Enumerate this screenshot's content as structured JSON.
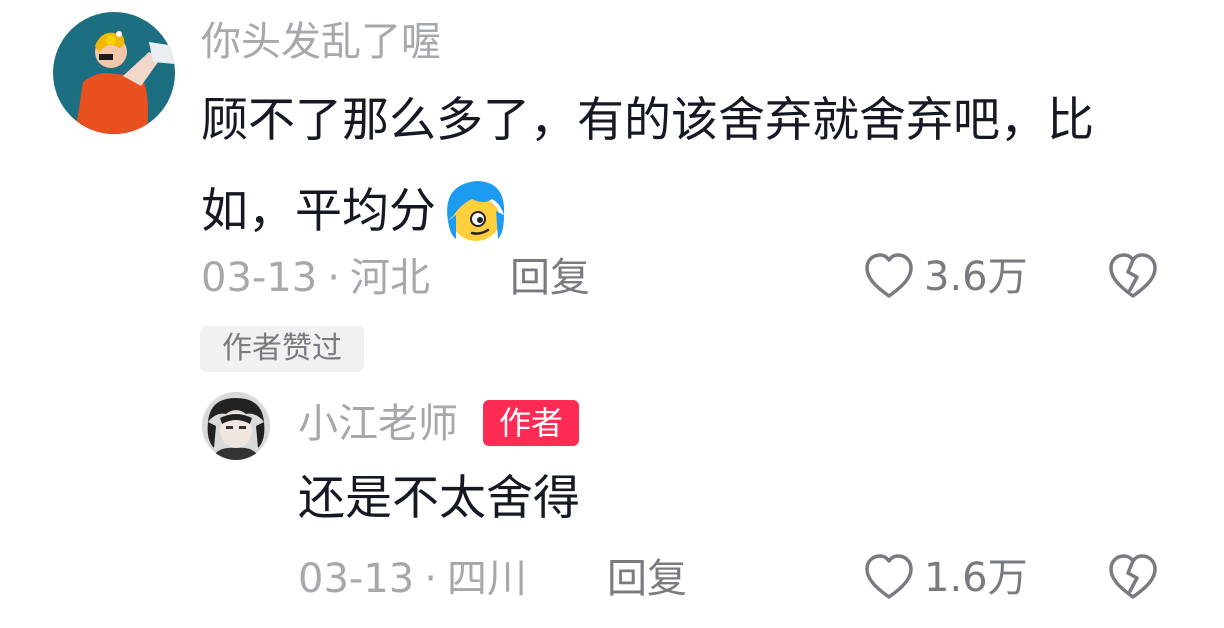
{
  "colors": {
    "username": "#a7a8ac",
    "text": "#161823",
    "meta": "#a7a8ac",
    "action": "#7a7b80",
    "author_badge_bg": "#fe2c55",
    "liked_badge_bg": "#f1f1f2"
  },
  "comment": {
    "username": "你头发乱了喔",
    "text_line1": "顾不了那么多了，有的该舍弃就舍弃吧，比",
    "text_line2": "如，平均分",
    "emoji_icon": "blue-hair-smirk-emoji",
    "date": "03-13",
    "separator": "·",
    "location": "河北",
    "reply_label": "回复",
    "like_count": "3.6万",
    "liked_by_author_badge": "作者赞过"
  },
  "reply": {
    "username": "小江老师",
    "author_badge": "作者",
    "text": "还是不太舍得",
    "date": "03-13",
    "separator": "·",
    "location": "四川",
    "reply_label": "回复",
    "like_count": "1.6万"
  }
}
